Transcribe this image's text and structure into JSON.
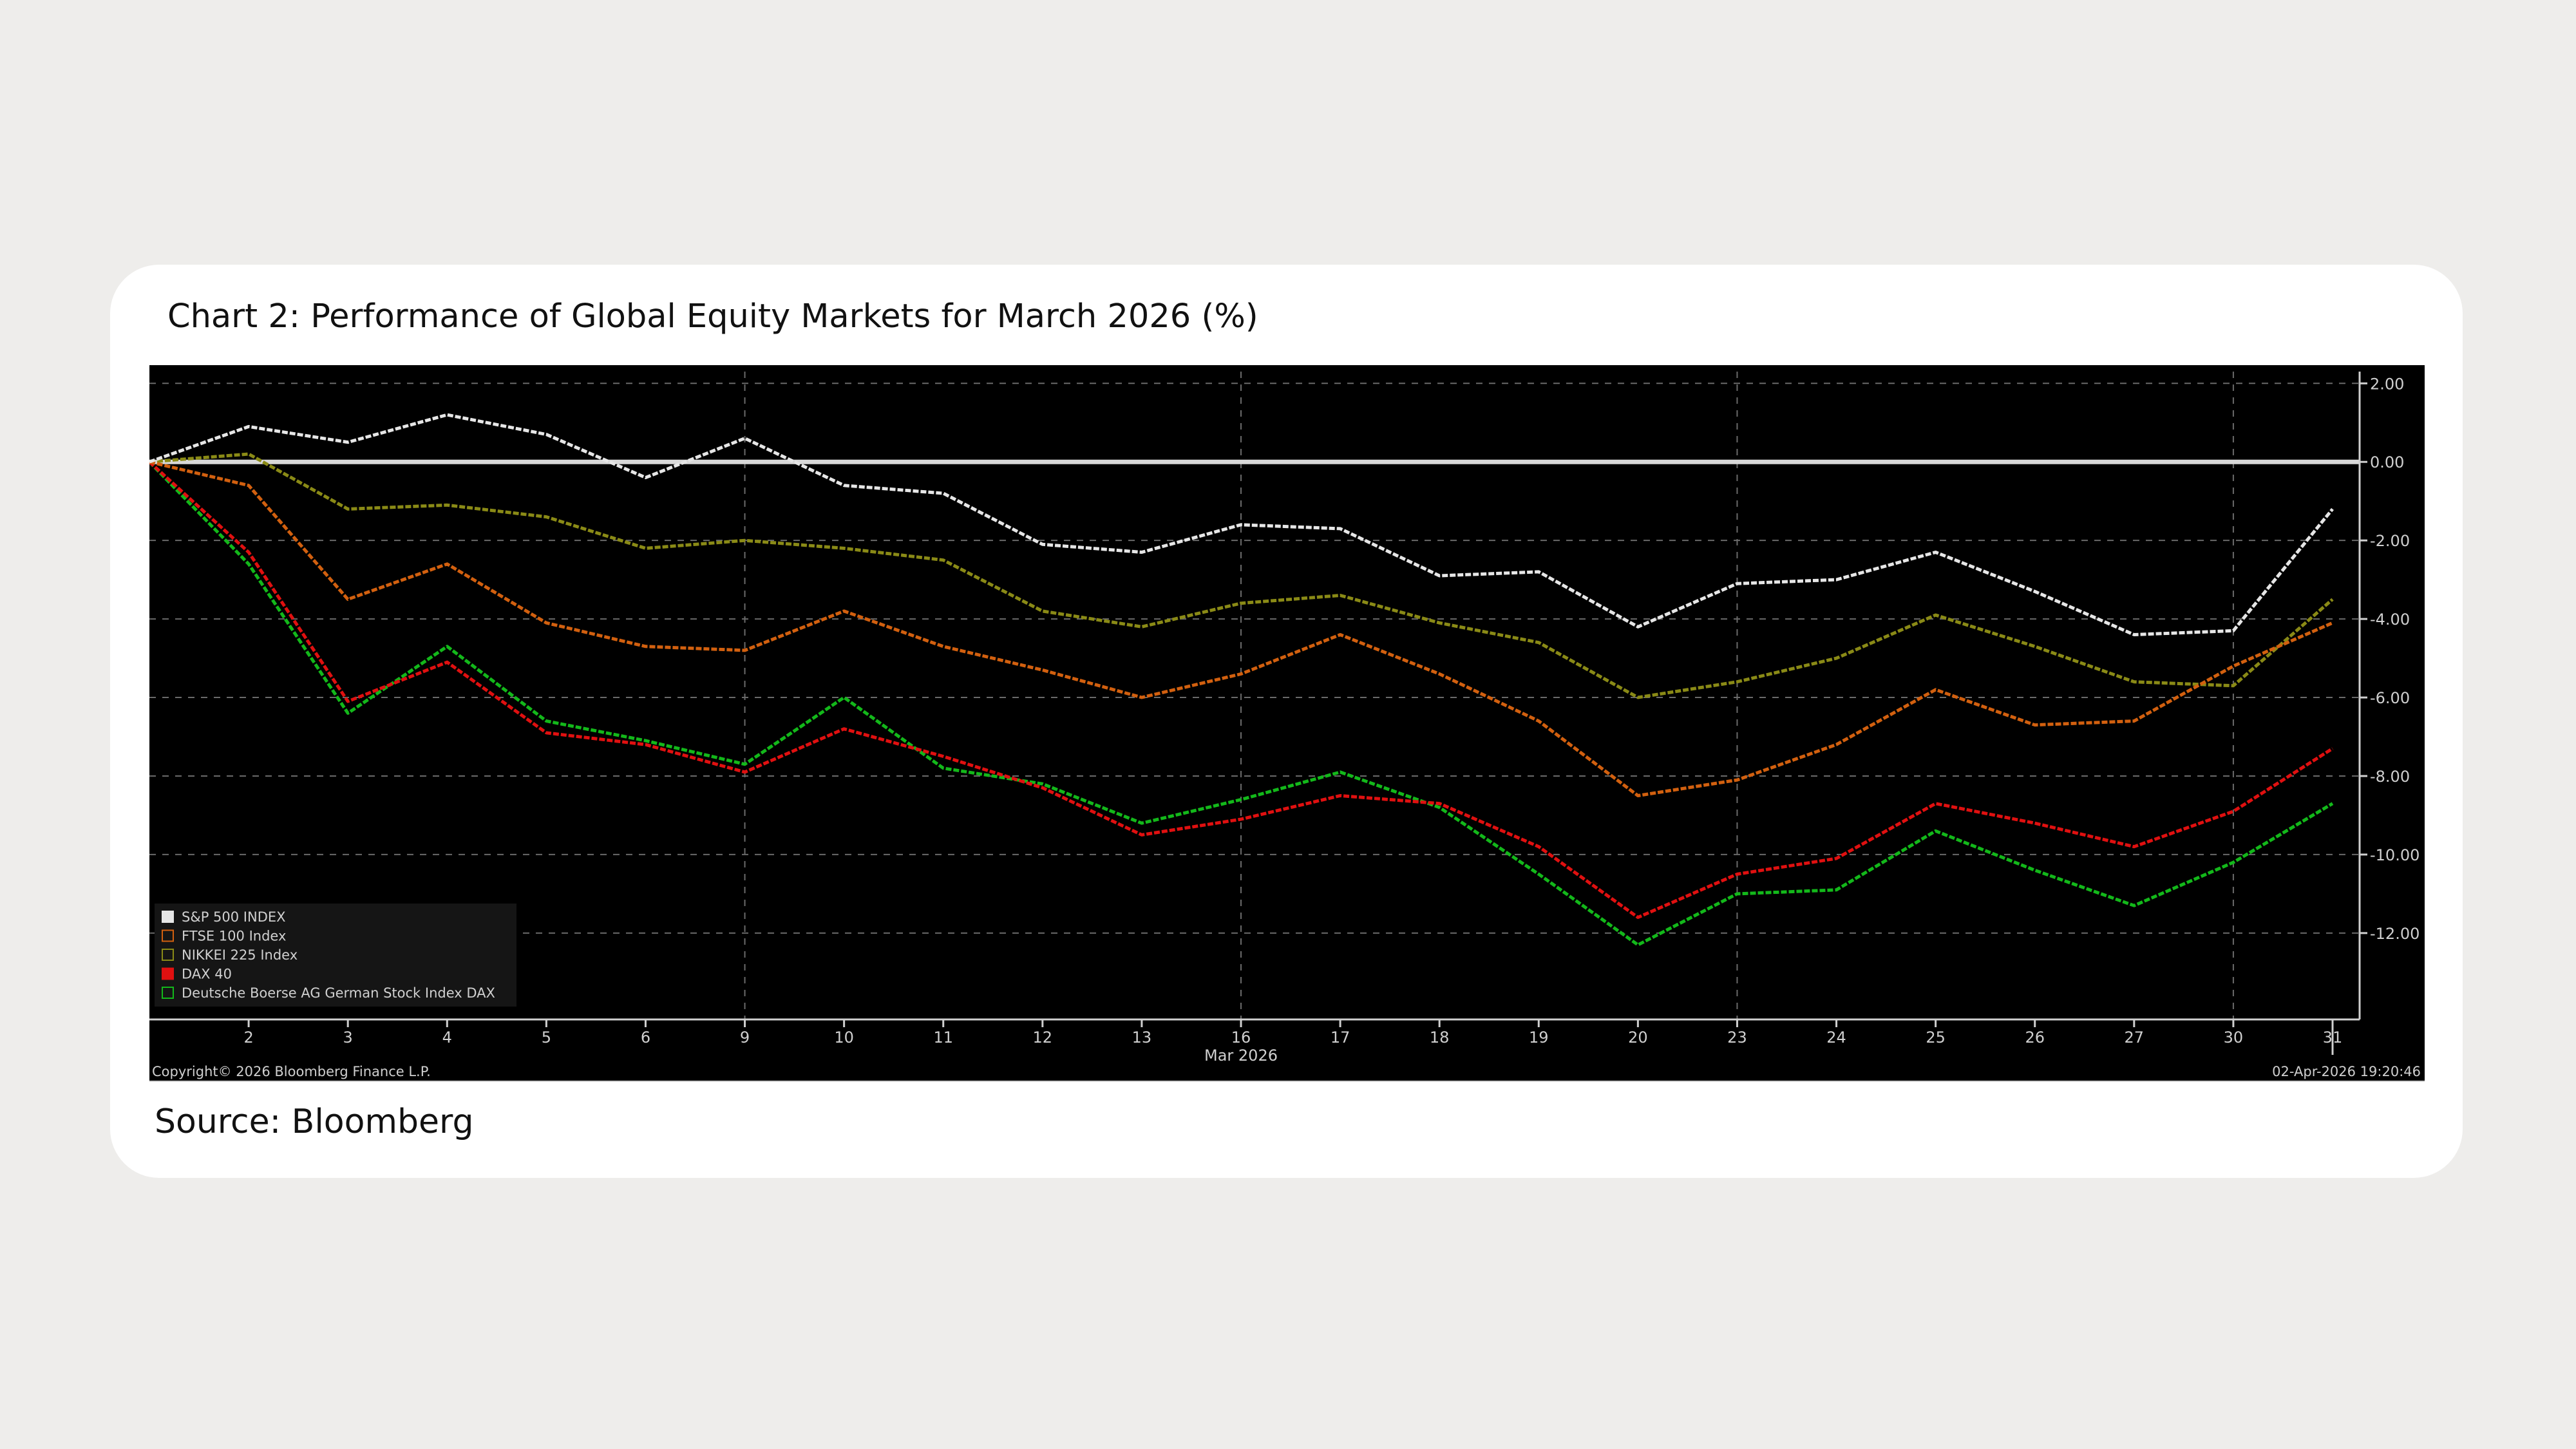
{
  "header": {
    "title": "Chart 2: Performance of Global Equity Markets for March 2026 (%)"
  },
  "footer": {
    "source": "Source: Bloomberg"
  },
  "colors": {
    "page_bg": "#eeedeb",
    "card_bg": "#ffffff",
    "chart_bg": "#000000",
    "axis": "#cfcfcf",
    "grid": "#6a6a6a",
    "legend_bg": "#151515"
  },
  "chart_data": {
    "type": "line",
    "title": "",
    "xlabel": "Mar 2026",
    "ylabel": "",
    "x": [
      "",
      "2",
      "3",
      "4",
      "5",
      "6",
      "9",
      "10",
      "11",
      "12",
      "13",
      "16",
      "17",
      "18",
      "19",
      "20",
      "23",
      "24",
      "25",
      "26",
      "27",
      "30",
      "31"
    ],
    "ylim": [
      -14.2,
      2.3
    ],
    "yticks": [
      2,
      0,
      -2,
      -4,
      -6,
      -8,
      -10,
      -12
    ],
    "ytick_labels": [
      "2.00",
      "0.00",
      "-2.00",
      "-4.00",
      "-6.00",
      "-8.00",
      "-10.00",
      "-12.00"
    ],
    "reference_line": 0,
    "grid": true,
    "y_axis_position": "right",
    "legend_position": "bottom-left",
    "series": [
      {
        "name": "S&P 500 INDEX",
        "color": "#e6e6e6",
        "values": [
          0.0,
          0.9,
          0.5,
          1.2,
          0.7,
          -0.4,
          0.6,
          -0.6,
          -0.8,
          -2.1,
          -2.3,
          -1.6,
          -1.7,
          -2.9,
          -2.8,
          -4.2,
          -3.1,
          -3.0,
          -2.3,
          -3.3,
          -4.4,
          -4.3,
          -1.2
        ]
      },
      {
        "name": "FTSE 100 Index",
        "color": "#d2600f",
        "values": [
          0.0,
          -0.6,
          -3.5,
          -2.6,
          -4.1,
          -4.7,
          -4.8,
          -3.8,
          -4.7,
          -5.3,
          -6.0,
          -5.4,
          -4.4,
          -5.4,
          -6.6,
          -8.5,
          -8.1,
          -7.2,
          -5.8,
          -6.7,
          -6.6,
          -5.2,
          -4.1
        ]
      },
      {
        "name": "NIKKEI 225 Index",
        "color": "#8a8a16",
        "values": [
          0.0,
          0.2,
          -1.2,
          -1.1,
          -1.4,
          -2.2,
          -2.0,
          -2.2,
          -2.5,
          -3.8,
          -4.2,
          -3.6,
          -3.4,
          -4.1,
          -4.6,
          -6.0,
          -5.6,
          -5.0,
          -3.9,
          -4.7,
          -5.6,
          -5.7,
          -3.5
        ]
      },
      {
        "name": "DAX 40",
        "color": "#e01010",
        "values": [
          0.0,
          -2.3,
          -6.1,
          -5.1,
          -6.9,
          -7.2,
          -7.9,
          -6.8,
          -7.5,
          -8.3,
          -9.5,
          -9.1,
          -8.5,
          -8.7,
          -9.8,
          -11.6,
          -10.5,
          -10.1,
          -8.7,
          -9.2,
          -9.8,
          -8.9,
          -7.3
        ]
      },
      {
        "name": "Deutsche Boerse AG German Stock Index DAX",
        "color": "#13b81a",
        "values": [
          0.0,
          -2.6,
          -6.4,
          -4.7,
          -6.6,
          -7.1,
          -7.7,
          -6.0,
          -7.8,
          -8.2,
          -9.2,
          -8.6,
          -7.9,
          -8.8,
          -10.5,
          -12.3,
          -11.0,
          -10.9,
          -9.4,
          -10.4,
          -11.3,
          -10.2,
          -8.7
        ]
      }
    ],
    "annotations": {
      "copyright": "Copyright© 2026 Bloomberg Finance L.P.",
      "timestamp": "02-Apr-2026 19:20:46"
    }
  }
}
